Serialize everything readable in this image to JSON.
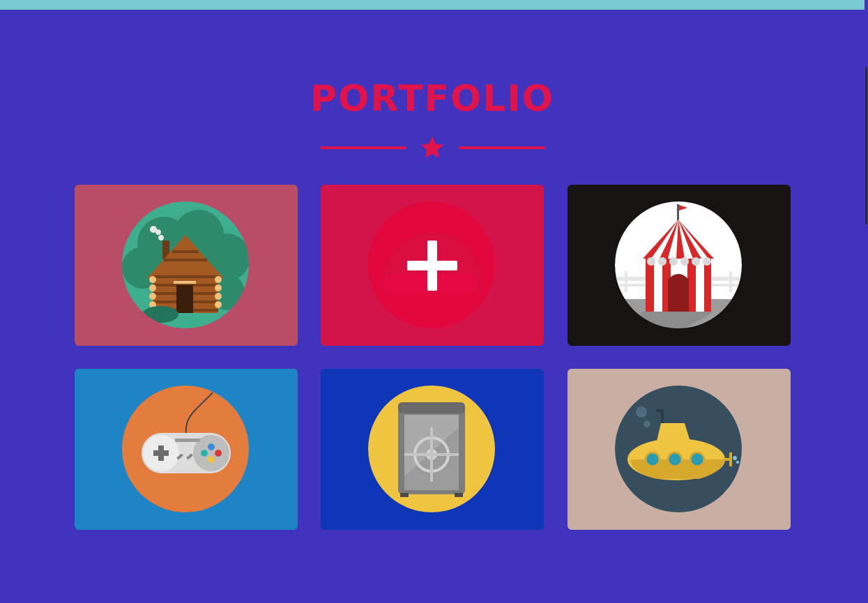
{
  "header": {
    "title": "PORTFOLIO"
  },
  "colors": {
    "background": "#4233bf",
    "accent": "#e0134a",
    "topbar": "#79cad3"
  },
  "portfolio": {
    "items": [
      {
        "icon": "log-cabin-icon",
        "card_color": "#b94d66",
        "circle_color": "#3fae8e"
      },
      {
        "icon": "plus-icon",
        "card_color": "#d3144a",
        "circle_color": "#e2083d",
        "state": "hover"
      },
      {
        "icon": "circus-tent-icon",
        "card_color": "#171313",
        "circle_color": "#ffffff"
      },
      {
        "icon": "game-controller-icon",
        "card_color": "#1f84c6",
        "circle_color": "#e37c3d"
      },
      {
        "icon": "safe-icon",
        "card_color": "#1036b8",
        "circle_color": "#eec441"
      },
      {
        "icon": "submarine-icon",
        "card_color": "#c9afa3",
        "circle_color": "#364e5e"
      }
    ]
  }
}
